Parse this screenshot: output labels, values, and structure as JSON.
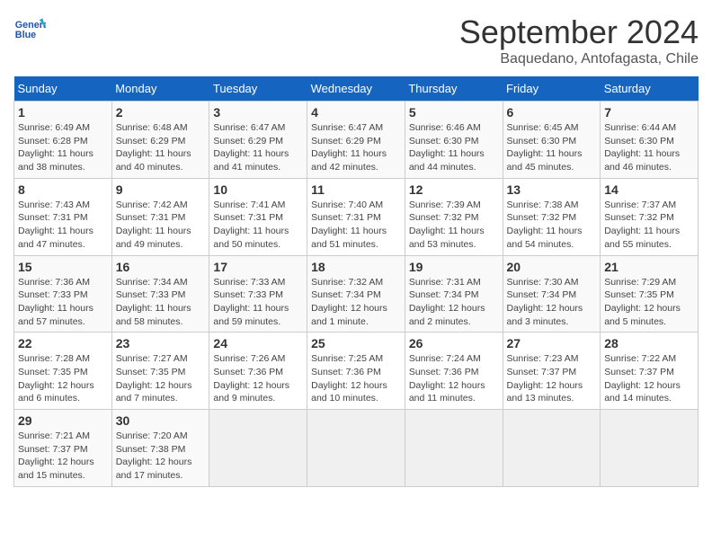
{
  "header": {
    "logo_line1": "General",
    "logo_line2": "Blue",
    "title": "September 2024",
    "subtitle": "Baquedano, Antofagasta, Chile"
  },
  "weekdays": [
    "Sunday",
    "Monday",
    "Tuesday",
    "Wednesday",
    "Thursday",
    "Friday",
    "Saturday"
  ],
  "weeks": [
    [
      {
        "day": "1",
        "sunrise": "Sunrise: 6:49 AM",
        "sunset": "Sunset: 6:28 PM",
        "daylight": "Daylight: 11 hours and 38 minutes."
      },
      {
        "day": "2",
        "sunrise": "Sunrise: 6:48 AM",
        "sunset": "Sunset: 6:29 PM",
        "daylight": "Daylight: 11 hours and 40 minutes."
      },
      {
        "day": "3",
        "sunrise": "Sunrise: 6:47 AM",
        "sunset": "Sunset: 6:29 PM",
        "daylight": "Daylight: 11 hours and 41 minutes."
      },
      {
        "day": "4",
        "sunrise": "Sunrise: 6:47 AM",
        "sunset": "Sunset: 6:29 PM",
        "daylight": "Daylight: 11 hours and 42 minutes."
      },
      {
        "day": "5",
        "sunrise": "Sunrise: 6:46 AM",
        "sunset": "Sunset: 6:30 PM",
        "daylight": "Daylight: 11 hours and 44 minutes."
      },
      {
        "day": "6",
        "sunrise": "Sunrise: 6:45 AM",
        "sunset": "Sunset: 6:30 PM",
        "daylight": "Daylight: 11 hours and 45 minutes."
      },
      {
        "day": "7",
        "sunrise": "Sunrise: 6:44 AM",
        "sunset": "Sunset: 6:30 PM",
        "daylight": "Daylight: 11 hours and 46 minutes."
      }
    ],
    [
      {
        "day": "8",
        "sunrise": "Sunrise: 7:43 AM",
        "sunset": "Sunset: 7:31 PM",
        "daylight": "Daylight: 11 hours and 47 minutes."
      },
      {
        "day": "9",
        "sunrise": "Sunrise: 7:42 AM",
        "sunset": "Sunset: 7:31 PM",
        "daylight": "Daylight: 11 hours and 49 minutes."
      },
      {
        "day": "10",
        "sunrise": "Sunrise: 7:41 AM",
        "sunset": "Sunset: 7:31 PM",
        "daylight": "Daylight: 11 hours and 50 minutes."
      },
      {
        "day": "11",
        "sunrise": "Sunrise: 7:40 AM",
        "sunset": "Sunset: 7:31 PM",
        "daylight": "Daylight: 11 hours and 51 minutes."
      },
      {
        "day": "12",
        "sunrise": "Sunrise: 7:39 AM",
        "sunset": "Sunset: 7:32 PM",
        "daylight": "Daylight: 11 hours and 53 minutes."
      },
      {
        "day": "13",
        "sunrise": "Sunrise: 7:38 AM",
        "sunset": "Sunset: 7:32 PM",
        "daylight": "Daylight: 11 hours and 54 minutes."
      },
      {
        "day": "14",
        "sunrise": "Sunrise: 7:37 AM",
        "sunset": "Sunset: 7:32 PM",
        "daylight": "Daylight: 11 hours and 55 minutes."
      }
    ],
    [
      {
        "day": "15",
        "sunrise": "Sunrise: 7:36 AM",
        "sunset": "Sunset: 7:33 PM",
        "daylight": "Daylight: 11 hours and 57 minutes."
      },
      {
        "day": "16",
        "sunrise": "Sunrise: 7:34 AM",
        "sunset": "Sunset: 7:33 PM",
        "daylight": "Daylight: 11 hours and 58 minutes."
      },
      {
        "day": "17",
        "sunrise": "Sunrise: 7:33 AM",
        "sunset": "Sunset: 7:33 PM",
        "daylight": "Daylight: 11 hours and 59 minutes."
      },
      {
        "day": "18",
        "sunrise": "Sunrise: 7:32 AM",
        "sunset": "Sunset: 7:34 PM",
        "daylight": "Daylight: 12 hours and 1 minute."
      },
      {
        "day": "19",
        "sunrise": "Sunrise: 7:31 AM",
        "sunset": "Sunset: 7:34 PM",
        "daylight": "Daylight: 12 hours and 2 minutes."
      },
      {
        "day": "20",
        "sunrise": "Sunrise: 7:30 AM",
        "sunset": "Sunset: 7:34 PM",
        "daylight": "Daylight: 12 hours and 3 minutes."
      },
      {
        "day": "21",
        "sunrise": "Sunrise: 7:29 AM",
        "sunset": "Sunset: 7:35 PM",
        "daylight": "Daylight: 12 hours and 5 minutes."
      }
    ],
    [
      {
        "day": "22",
        "sunrise": "Sunrise: 7:28 AM",
        "sunset": "Sunset: 7:35 PM",
        "daylight": "Daylight: 12 hours and 6 minutes."
      },
      {
        "day": "23",
        "sunrise": "Sunrise: 7:27 AM",
        "sunset": "Sunset: 7:35 PM",
        "daylight": "Daylight: 12 hours and 7 minutes."
      },
      {
        "day": "24",
        "sunrise": "Sunrise: 7:26 AM",
        "sunset": "Sunset: 7:36 PM",
        "daylight": "Daylight: 12 hours and 9 minutes."
      },
      {
        "day": "25",
        "sunrise": "Sunrise: 7:25 AM",
        "sunset": "Sunset: 7:36 PM",
        "daylight": "Daylight: 12 hours and 10 minutes."
      },
      {
        "day": "26",
        "sunrise": "Sunrise: 7:24 AM",
        "sunset": "Sunset: 7:36 PM",
        "daylight": "Daylight: 12 hours and 11 minutes."
      },
      {
        "day": "27",
        "sunrise": "Sunrise: 7:23 AM",
        "sunset": "Sunset: 7:37 PM",
        "daylight": "Daylight: 12 hours and 13 minutes."
      },
      {
        "day": "28",
        "sunrise": "Sunrise: 7:22 AM",
        "sunset": "Sunset: 7:37 PM",
        "daylight": "Daylight: 12 hours and 14 minutes."
      }
    ],
    [
      {
        "day": "29",
        "sunrise": "Sunrise: 7:21 AM",
        "sunset": "Sunset: 7:37 PM",
        "daylight": "Daylight: 12 hours and 15 minutes."
      },
      {
        "day": "30",
        "sunrise": "Sunrise: 7:20 AM",
        "sunset": "Sunset: 7:38 PM",
        "daylight": "Daylight: 12 hours and 17 minutes."
      },
      null,
      null,
      null,
      null,
      null
    ]
  ]
}
